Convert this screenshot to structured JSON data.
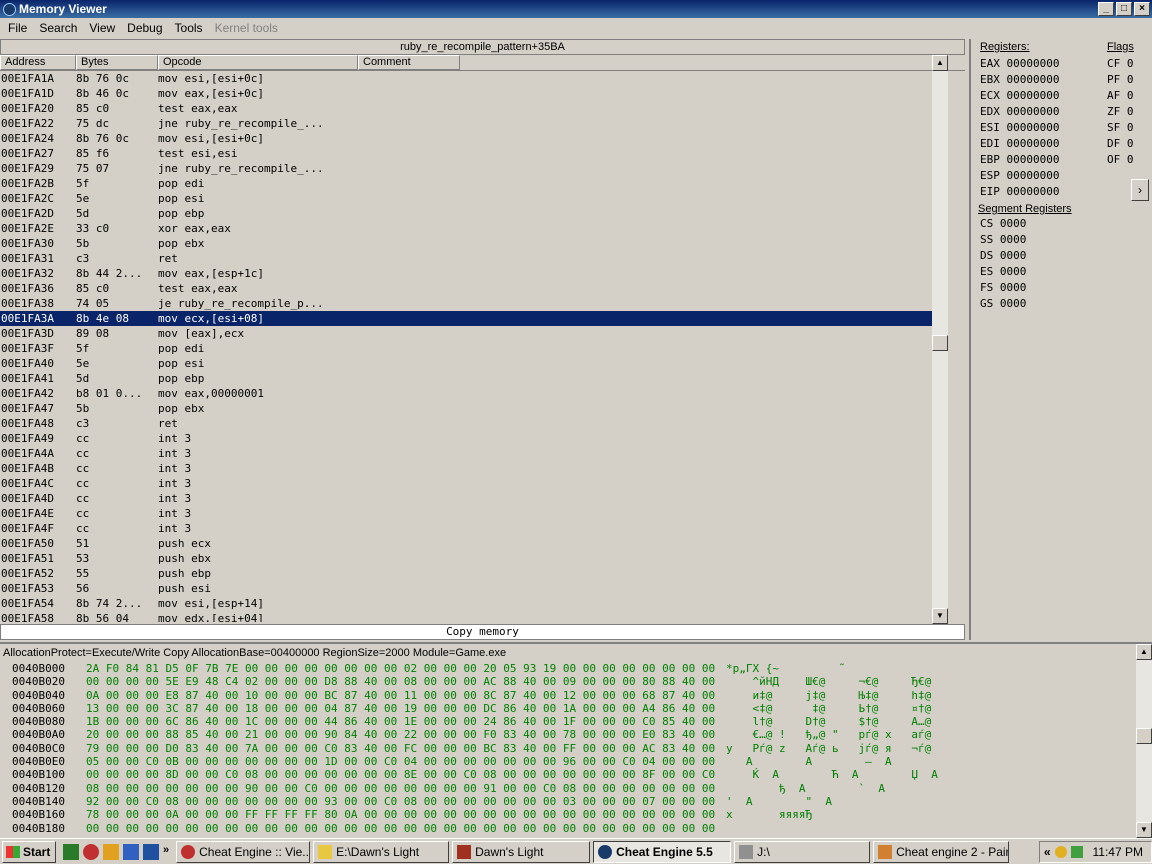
{
  "window": {
    "title": "Memory Viewer"
  },
  "menu": [
    "File",
    "Search",
    "View",
    "Debug",
    "Tools",
    "Kernel tools"
  ],
  "disassembler": {
    "title": "ruby_re_recompile_pattern+35BA",
    "columns": [
      "Address",
      "Bytes",
      "Opcode",
      "Comment"
    ],
    "selected_address": "00E1FA3A",
    "rows": [
      [
        "00E1FA1A",
        "8b 76 0c",
        "mov esi,[esi+0c]"
      ],
      [
        "00E1FA1D",
        "8b 46 0c",
        "mov eax,[esi+0c]"
      ],
      [
        "00E1FA20",
        "85 c0",
        "test eax,eax"
      ],
      [
        "00E1FA22",
        "75 dc",
        "jne ruby_re_recompile_..."
      ],
      [
        "00E1FA24",
        "8b 76 0c",
        "mov esi,[esi+0c]"
      ],
      [
        "00E1FA27",
        "85 f6",
        "test esi,esi"
      ],
      [
        "00E1FA29",
        "75 07",
        "jne ruby_re_recompile_..."
      ],
      [
        "00E1FA2B",
        "5f",
        "pop edi"
      ],
      [
        "00E1FA2C",
        "5e",
        "pop esi"
      ],
      [
        "00E1FA2D",
        "5d",
        "pop ebp"
      ],
      [
        "00E1FA2E",
        "33 c0",
        "xor eax,eax"
      ],
      [
        "00E1FA30",
        "5b",
        "pop ebx"
      ],
      [
        "00E1FA31",
        "c3",
        "ret"
      ],
      [
        "00E1FA32",
        "8b 44 2...",
        "mov eax,[esp+1c]"
      ],
      [
        "00E1FA36",
        "85 c0",
        "test eax,eax"
      ],
      [
        "00E1FA38",
        "74 05",
        "je ruby_re_recompile_p..."
      ],
      [
        "00E1FA3A",
        "8b 4e 08",
        "mov ecx,[esi+08]"
      ],
      [
        "00E1FA3D",
        "89 08",
        "mov [eax],ecx"
      ],
      [
        "00E1FA3F",
        "5f",
        "pop edi"
      ],
      [
        "00E1FA40",
        "5e",
        "pop esi"
      ],
      [
        "00E1FA41",
        "5d",
        "pop ebp"
      ],
      [
        "00E1FA42",
        "b8 01 0...",
        "mov eax,00000001"
      ],
      [
        "00E1FA47",
        "5b",
        "pop ebx"
      ],
      [
        "00E1FA48",
        "c3",
        "ret"
      ],
      [
        "00E1FA49",
        "cc",
        "int 3"
      ],
      [
        "00E1FA4A",
        "cc",
        "int 3"
      ],
      [
        "00E1FA4B",
        "cc",
        "int 3"
      ],
      [
        "00E1FA4C",
        "cc",
        "int 3"
      ],
      [
        "00E1FA4D",
        "cc",
        "int 3"
      ],
      [
        "00E1FA4E",
        "cc",
        "int 3"
      ],
      [
        "00E1FA4F",
        "cc",
        "int 3"
      ],
      [
        "00E1FA50",
        "51",
        "push ecx"
      ],
      [
        "00E1FA51",
        "53",
        "push ebx"
      ],
      [
        "00E1FA52",
        "55",
        "push ebp"
      ],
      [
        "00E1FA53",
        "56",
        "push esi"
      ],
      [
        "00E1FA54",
        "8b 74 2...",
        "mov esi,[esp+14]"
      ],
      [
        "00E1FA58",
        "8b 56 04",
        "mov edx,[esi+04]"
      ]
    ],
    "copy_memory": "Copy memory"
  },
  "registers": {
    "header": "Registers:",
    "flags_header": "Flags",
    "segment_header": "Segment Registers",
    "regs": [
      [
        "EAX",
        "00000000"
      ],
      [
        "EBX",
        "00000000"
      ],
      [
        "ECX",
        "00000000"
      ],
      [
        "EDX",
        "00000000"
      ],
      [
        "ESI",
        "00000000"
      ],
      [
        "EDI",
        "00000000"
      ],
      [
        "EBP",
        "00000000"
      ],
      [
        "ESP",
        "00000000"
      ],
      [
        "EIP",
        "00000000"
      ]
    ],
    "flags": [
      [
        "CF",
        "0"
      ],
      [
        "PF",
        "0"
      ],
      [
        "AF",
        "0"
      ],
      [
        "ZF",
        "0"
      ],
      [
        "SF",
        "0"
      ],
      [
        "DF",
        "0"
      ],
      [
        "OF",
        "0"
      ]
    ],
    "segments": [
      [
        "CS",
        "0000"
      ],
      [
        "SS",
        "0000"
      ],
      [
        "DS",
        "0000"
      ],
      [
        "ES",
        "0000"
      ],
      [
        "FS",
        "0000"
      ],
      [
        "GS",
        "0000"
      ]
    ]
  },
  "hexview": {
    "info": "AllocationProtect=Execute/Write Copy  AllocationBase=00400000 RegionSize=2000 Module=Game.exe",
    "rows": [
      [
        "0040B000",
        "2A F0 84 81 D5 0F 7B 7E 00 00 00 00 00 00 00 00 02 00 00 00 20 05 93 19 00 00 00 00 00 00 00 00",
        "*р„ГХ {~         ˜"
      ],
      [
        "0040B020",
        "00 00 00 00 5E E9 48 C4 02 00 00 00 D8 88 40 00 08 00 00 00 AC 88 40 00 09 00 00 00 80 88 40 00",
        "    ^йНД    Ш€@     ¬€@     Ђ€@"
      ],
      [
        "0040B040",
        "0A 00 00 00 E8 87 40 00 10 00 00 00 BC 87 40 00 11 00 00 00 8C 87 40 00 12 00 00 00 68 87 40 00",
        "    и‡@     ј‡@     Њ‡@     h‡@"
      ],
      [
        "0040B060",
        "13 00 00 00 3C 87 40 00 18 00 00 00 04 87 40 00 19 00 00 00 DC 86 40 00 1A 00 00 00 A4 86 40 00",
        "    <‡@      ‡@     Ь†@     ¤†@"
      ],
      [
        "0040B080",
        "1B 00 00 00 6C 86 40 00 1C 00 00 00 44 86 40 00 1E 00 00 00 24 86 40 00 1F 00 00 00 C0 85 40 00",
        "    l†@     D†@     $†@     А…@"
      ],
      [
        "0040B0A0",
        "20 00 00 00 88 85 40 00 21 00 00 00 90 84 40 00 22 00 00 00 F0 83 40 00 78 00 00 00 E0 83 40 00",
        "    €…@ !   ђ„@ \"   рѓ@ x   аѓ@"
      ],
      [
        "0040B0C0",
        "79 00 00 00 D0 83 40 00 7A 00 00 00 C0 83 40 00 FC 00 00 00 BC 83 40 00 FF 00 00 00 AC 83 40 00",
        "y   Рѓ@ z   Аѓ@ ь   јѓ@ я   ¬ѓ@"
      ],
      [
        "0040B0E0",
        "05 00 00 C0 0B 00 00 00 00 00 00 00 1D 00 00 C0 04 00 00 00 00 00 00 00 96 00 00 C0 04 00 00 00",
        "   А        А        –  А"
      ],
      [
        "0040B100",
        "00 00 00 00 8D 00 00 C0 08 00 00 00 00 00 00 00 8E 00 00 C0 08 00 00 00 00 00 00 00 8F 00 00 C0",
        "    Ќ  А        Ћ  А        Џ  А"
      ],
      [
        "0040B120",
        "08 00 00 00 00 00 00 00 90 00 00 C0 00 00 00 00 00 00 00 00 91 00 00 C0 08 00 00 00 00 00 00 00",
        "        ђ  А        `  А"
      ],
      [
        "0040B140",
        "92 00 00 C0 08 00 00 00 00 00 00 00 93 00 00 C0 08 00 00 00 00 00 00 00 03 00 00 00 07 00 00 00",
        "'  А        \"  А"
      ],
      [
        "0040B160",
        "78 00 00 00 0A 00 00 00 FF FF FF FF 80 0A 00 00 00 00 00 00 00 00 00 00 00 00 00 00 00 00 00 00",
        "x       яяяяЂ"
      ],
      [
        "0040B180",
        "00 00 00 00 00 00 00 00 00 00 00 00 00 00 00 00 00 00 00 00 00 00 00 00 00 00 00 00 00 00 00 00",
        ""
      ]
    ]
  },
  "taskbar": {
    "start": "Start",
    "tasks": [
      "Cheat Engine :: Vie...",
      "E:\\Dawn's Light",
      "Dawn's Light",
      "Cheat Engine 5.5",
      "J:\\",
      "Cheat engine 2 - Paint"
    ],
    "active_task": "Cheat Engine 5.5",
    "clock": "11:47 PM"
  }
}
